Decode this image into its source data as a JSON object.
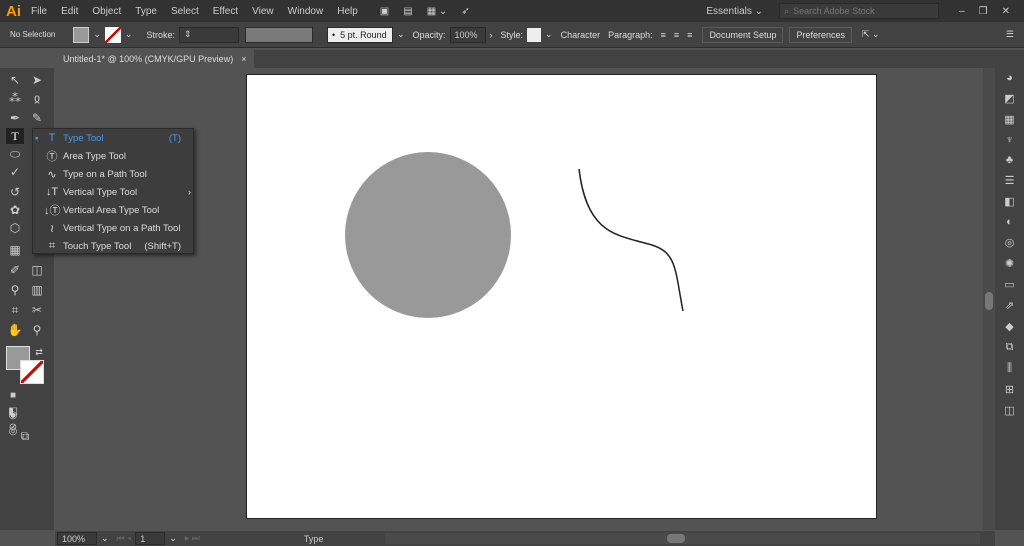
{
  "app": {
    "logo": "Ai",
    "menus": [
      "File",
      "Edit",
      "Object",
      "Type",
      "Select",
      "Effect",
      "View",
      "Window",
      "Help"
    ],
    "workspace": "Essentials",
    "search_placeholder": "Search Adobe Stock"
  },
  "control": {
    "selection": "No Selection",
    "stroke_label": "Stroke:",
    "brush": "5 pt. Round",
    "opacity_label": "Opacity:",
    "opacity": "100%",
    "style_label": "Style:",
    "character": "Character",
    "paragraph": "Paragraph:",
    "doc_setup": "Document Setup",
    "preferences": "Preferences"
  },
  "document": {
    "tab_title": "Untitled-1* @ 100% (CMYK/GPU Preview)",
    "close": "×"
  },
  "flyout": {
    "items": [
      {
        "label": "Type Tool",
        "shortcut": "(T)",
        "icon": "T"
      },
      {
        "label": "Area Type Tool",
        "shortcut": "",
        "icon": "Ⓣ"
      },
      {
        "label": "Type on a Path Tool",
        "shortcut": "",
        "icon": "∿"
      },
      {
        "label": "Vertical Type Tool",
        "shortcut": "",
        "icon": "↓T"
      },
      {
        "label": "Vertical Area Type Tool",
        "shortcut": "",
        "icon": "↓Ⓣ"
      },
      {
        "label": "Vertical Type on a Path Tool",
        "shortcut": "",
        "icon": "≀"
      },
      {
        "label": "Touch Type Tool",
        "shortcut": "(Shift+T)",
        "icon": "⌗"
      }
    ]
  },
  "status": {
    "zoom": "100%",
    "page": "1",
    "tool": "Type"
  },
  "colors": {
    "circle": "#999999",
    "accent": "#4a9be8"
  }
}
